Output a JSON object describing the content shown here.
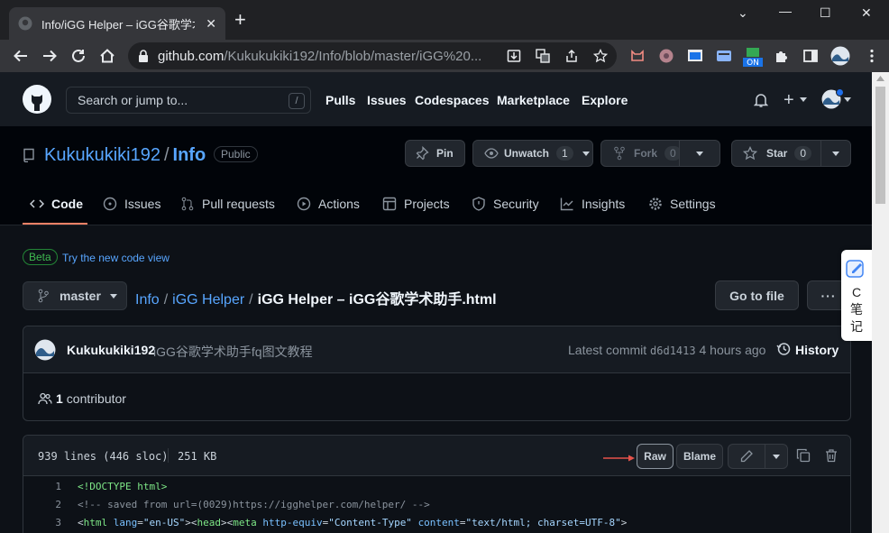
{
  "browser": {
    "tab_title": "Info/iGG Helper – iGG谷歌学术",
    "url_host": "github.com",
    "url_path": "/Kukukukiki192/Info/blob/master/iGG%20..."
  },
  "header": {
    "search_placeholder": "Search or jump to...",
    "slash_key": "/",
    "nav": [
      "Pulls",
      "Issues",
      "Codespaces",
      "Marketplace",
      "Explore"
    ]
  },
  "repo": {
    "owner": "Kukukukiki192",
    "separator": "/",
    "name": "Info",
    "visibility": "Public",
    "pin_label": "Pin",
    "unwatch_label": "Unwatch",
    "unwatch_count": "1",
    "fork_label": "Fork",
    "fork_count": "0",
    "star_label": "Star",
    "star_count": "0"
  },
  "tabs": [
    "Code",
    "Issues",
    "Pull requests",
    "Actions",
    "Projects",
    "Security",
    "Insights",
    "Settings"
  ],
  "beta": {
    "badge": "Beta",
    "link": "Try the new code view"
  },
  "file_nav": {
    "branch": "master",
    "crumb_repo": "Info",
    "crumb_folder": "iGG Helper",
    "crumb_file": "iGG Helper – iGG谷歌学术助手.html",
    "goto_file": "Go to file",
    "more": "···"
  },
  "commit": {
    "author": "Kukukukiki192",
    "message": "iGG谷歌学术助手fq图文教程",
    "latest_label": "Latest commit",
    "sha": "d6d1413",
    "time": "4 hours ago",
    "history_label": "History",
    "contributors_count": "1",
    "contributors_label": "contributor"
  },
  "file": {
    "lines_info": "939 lines (446 sloc)",
    "size": "251 KB",
    "raw_label": "Raw",
    "blame_label": "Blame"
  },
  "code_lines": [
    {
      "n": "1",
      "text": "<!DOCTYPE html>"
    },
    {
      "n": "2",
      "text": "<!-- saved from url=(0029)https://igghelper.com/helper/ -->"
    },
    {
      "n": "3",
      "text": "<html lang=\"en-US\"><head><meta http-equiv=\"Content-Type\" content=\"text/html; charset=UTF-8\">"
    }
  ],
  "side_note": {
    "text": "C笔记"
  },
  "colors": {
    "accent": "#58a6ff",
    "underline": "#f78166",
    "arrow": "#e5534b"
  }
}
